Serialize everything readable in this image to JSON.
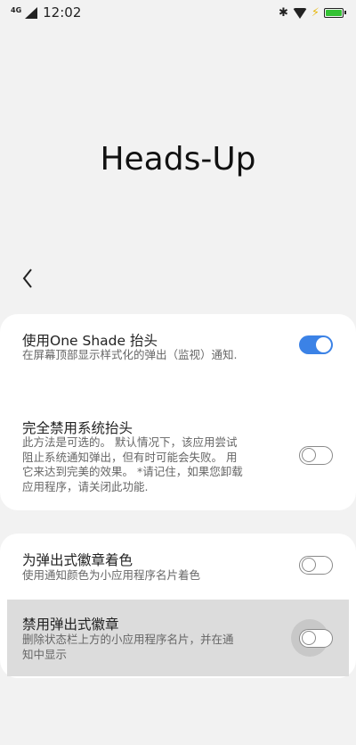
{
  "status_bar": {
    "network": "4G",
    "time": "12:02",
    "battery_level": 1.0,
    "battery_color": "#34c234"
  },
  "page": {
    "title": "Heads-Up",
    "back_icon": "chevron-left-icon"
  },
  "settings": {
    "card1": [
      {
        "title": "使用One Shade 抬头",
        "description": "在屏幕顶部显示样式化的弹出（监视）通知.",
        "enabled": true
      },
      {
        "title": "完全禁用系统抬头",
        "description_lines": [
          "此方法是可选的。 默认情况下，该应用尝试",
          "阻止系统通知弹出，但有时可能会失败。 用",
          "它来达到完美的效果。 *请记住，如果您卸载",
          "应用程序，请关闭此功能."
        ],
        "enabled": false
      }
    ],
    "card2": [
      {
        "title": "为弹出式徽章着色",
        "description": "使用通知颜色为小应用程序名片着色",
        "enabled": false
      },
      {
        "title": "禁用弹出式徽章",
        "description_lines": [
          "删除状态栏上方的小应用程序名片，并在通",
          "知中显示"
        ],
        "enabled": false,
        "pressed": true
      }
    ]
  },
  "colors": {
    "accent": "#3b82e6",
    "background": "#f2f2f2",
    "card": "#ffffff"
  }
}
